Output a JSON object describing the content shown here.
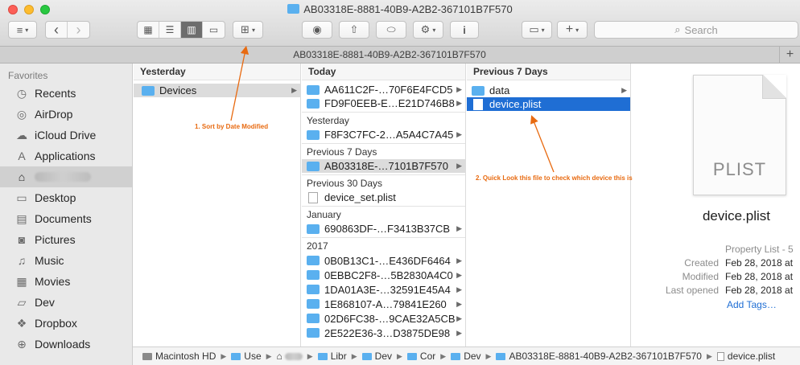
{
  "window": {
    "title": "AB03318E-8881-40B9-A2B2-367101B7F570"
  },
  "toolbar": {
    "view_list": "≡",
    "nav_back": "‹",
    "nav_forward": "›",
    "view_modes": [
      "▦",
      "☰",
      "▥",
      "▭"
    ],
    "group": "⊞",
    "quicklook": "◉",
    "share": "⇧",
    "tag": "⬭",
    "action": "⚙",
    "info": "i",
    "sidebar": "▭",
    "add": "+",
    "search_placeholder": "Search"
  },
  "tab": {
    "title": "AB03318E-8881-40B9-A2B2-367101B7F570",
    "plus": "+"
  },
  "sidebar": {
    "header": "Favorites",
    "items": [
      {
        "label": "Recents",
        "icon": "clock-icon"
      },
      {
        "label": "AirDrop",
        "icon": "airdrop-icon"
      },
      {
        "label": "iCloud Drive",
        "icon": "cloud-icon"
      },
      {
        "label": "Applications",
        "icon": "applications-icon"
      },
      {
        "label": "",
        "icon": "home-icon",
        "selected": true
      },
      {
        "label": "Desktop",
        "icon": "desktop-icon"
      },
      {
        "label": "Documents",
        "icon": "documents-icon"
      },
      {
        "label": "Pictures",
        "icon": "camera-icon"
      },
      {
        "label": "Music",
        "icon": "music-icon"
      },
      {
        "label": "Movies",
        "icon": "film-icon"
      },
      {
        "label": "Dev",
        "icon": "folder-icon"
      },
      {
        "label": "Dropbox",
        "icon": "dropbox-icon"
      },
      {
        "label": "Downloads",
        "icon": "downloads-icon"
      }
    ]
  },
  "columns": {
    "col1": {
      "header": "Yesterday",
      "items": [
        "Devices"
      ]
    },
    "col2": {
      "header": "Today",
      "today": [
        "AA611C2F-…70F6E4FCD5",
        "FD9F0EEB-E…E21D746B8"
      ],
      "yesterday_label": "Yesterday",
      "yesterday": [
        "F8F3C7FC-2…A5A4C7A45"
      ],
      "prev7_label": "Previous 7 Days",
      "prev7": [
        "AB03318E-…7101B7F570"
      ],
      "prev30_label": "Previous 30 Days",
      "prev30": [
        "device_set.plist"
      ],
      "january_label": "January",
      "january": [
        "690863DF-…F3413B37CB"
      ],
      "y2017_label": "2017",
      "y2017": [
        "0B0B13C1-…E436DF6464",
        "0EBBC2F8-…5B2830A4C0",
        "1DA01A3E-…32591E45A4",
        "1E868107-A…79841E260",
        "02D6FC38-…9CAE32A5CB",
        "2E522E36-3…D3875DE98"
      ]
    },
    "col3": {
      "header": "Previous 7 Days",
      "items": [
        "data",
        "device.plist"
      ]
    }
  },
  "preview": {
    "icon_label": "PLIST",
    "name": "device.plist",
    "kind": "Property List - 5",
    "created_label": "Created",
    "created": "Feb 28, 2018 at",
    "modified_label": "Modified",
    "modified": "Feb 28, 2018 at",
    "opened_label": "Last opened",
    "opened": "Feb 28, 2018 at",
    "add_tags": "Add Tags…"
  },
  "pathbar": [
    "Macintosh HD",
    "Use",
    "",
    "Libr",
    "Dev",
    "Cor",
    "Dev",
    "AB03318E-8881-40B9-A2B2-367101B7F570",
    "device.plist"
  ],
  "annotations": {
    "a1": "1. Sort by Date Modified",
    "a2": "2. Quick Look this file to check which device this is"
  },
  "colors": {
    "accent": "#1f6ed4",
    "annotation": "#e86a10",
    "folder": "#5ab0ef"
  }
}
